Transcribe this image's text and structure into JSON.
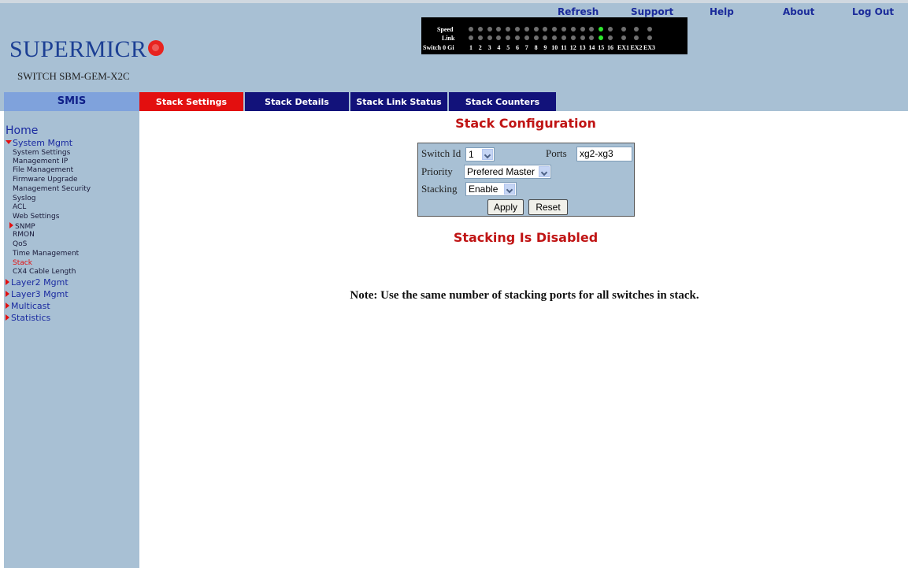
{
  "header": {
    "logo_text": "SUPERMICR",
    "switch_model": "SWITCH SBM-GEM-X2C",
    "nav_links": [
      "Refresh",
      "Support",
      "Help",
      "About",
      "Log Out"
    ]
  },
  "port_panel": {
    "row_labels": [
      "Speed",
      "Link"
    ],
    "port_label_prefix": "Switch 0 Gi",
    "ports": [
      "1",
      "2",
      "3",
      "4",
      "5",
      "6",
      "7",
      "8",
      "9",
      "10",
      "11",
      "12",
      "13",
      "14",
      "15",
      "16",
      "EX1",
      "EX2",
      "EX3"
    ],
    "speed_on_ports": [
      "15"
    ],
    "link_on_ports": [
      "15"
    ],
    "led_on_color": "#2ee82e",
    "led_off_color": "#6f6f6f"
  },
  "tabs": {
    "smis_label": "SMIS",
    "items": [
      {
        "label": "Stack Settings",
        "active": true
      },
      {
        "label": "Stack Details",
        "active": false
      },
      {
        "label": "Stack Link Status",
        "active": false
      },
      {
        "label": "Stack Counters",
        "active": false
      }
    ]
  },
  "sidebar": {
    "home": "Home",
    "menus": [
      {
        "label": "System Mgmt",
        "expanded": true
      },
      {
        "label": "Layer2 Mgmt",
        "expanded": false
      },
      {
        "label": "Layer3 Mgmt",
        "expanded": false
      },
      {
        "label": "Multicast",
        "expanded": false
      },
      {
        "label": "Statistics",
        "expanded": false
      }
    ],
    "system_mgmt_items": [
      "System Settings",
      "Management IP",
      "File Management",
      "Firmware Upgrade",
      "Management Security",
      "Syslog",
      "ACL",
      "Web Settings",
      "SNMP",
      "RMON",
      "QoS",
      "Time Management",
      "Stack",
      "CX4 Cable Length"
    ],
    "current_item": "Stack",
    "collapsible_subitem": "SNMP"
  },
  "main": {
    "title": "Stack Configuration",
    "form": {
      "switch_id_label": "Switch Id",
      "switch_id_value": "1",
      "ports_label": "Ports",
      "ports_value": "xg2-xg3",
      "priority_label": "Priority",
      "priority_value": "Prefered Master",
      "stacking_label": "Stacking",
      "stacking_value": "Enable",
      "apply_label": "Apply",
      "reset_label": "Reset"
    },
    "status": "Stacking Is Disabled",
    "note": "Note: Use the same number of stacking ports for all switches in stack."
  },
  "colors": {
    "panel_bg": "#a8c0d4",
    "tab_active": "#e30f0f",
    "tab_inactive": "#12127a",
    "heading_red": "#c01414",
    "logo_blue": "#1c3f94"
  }
}
